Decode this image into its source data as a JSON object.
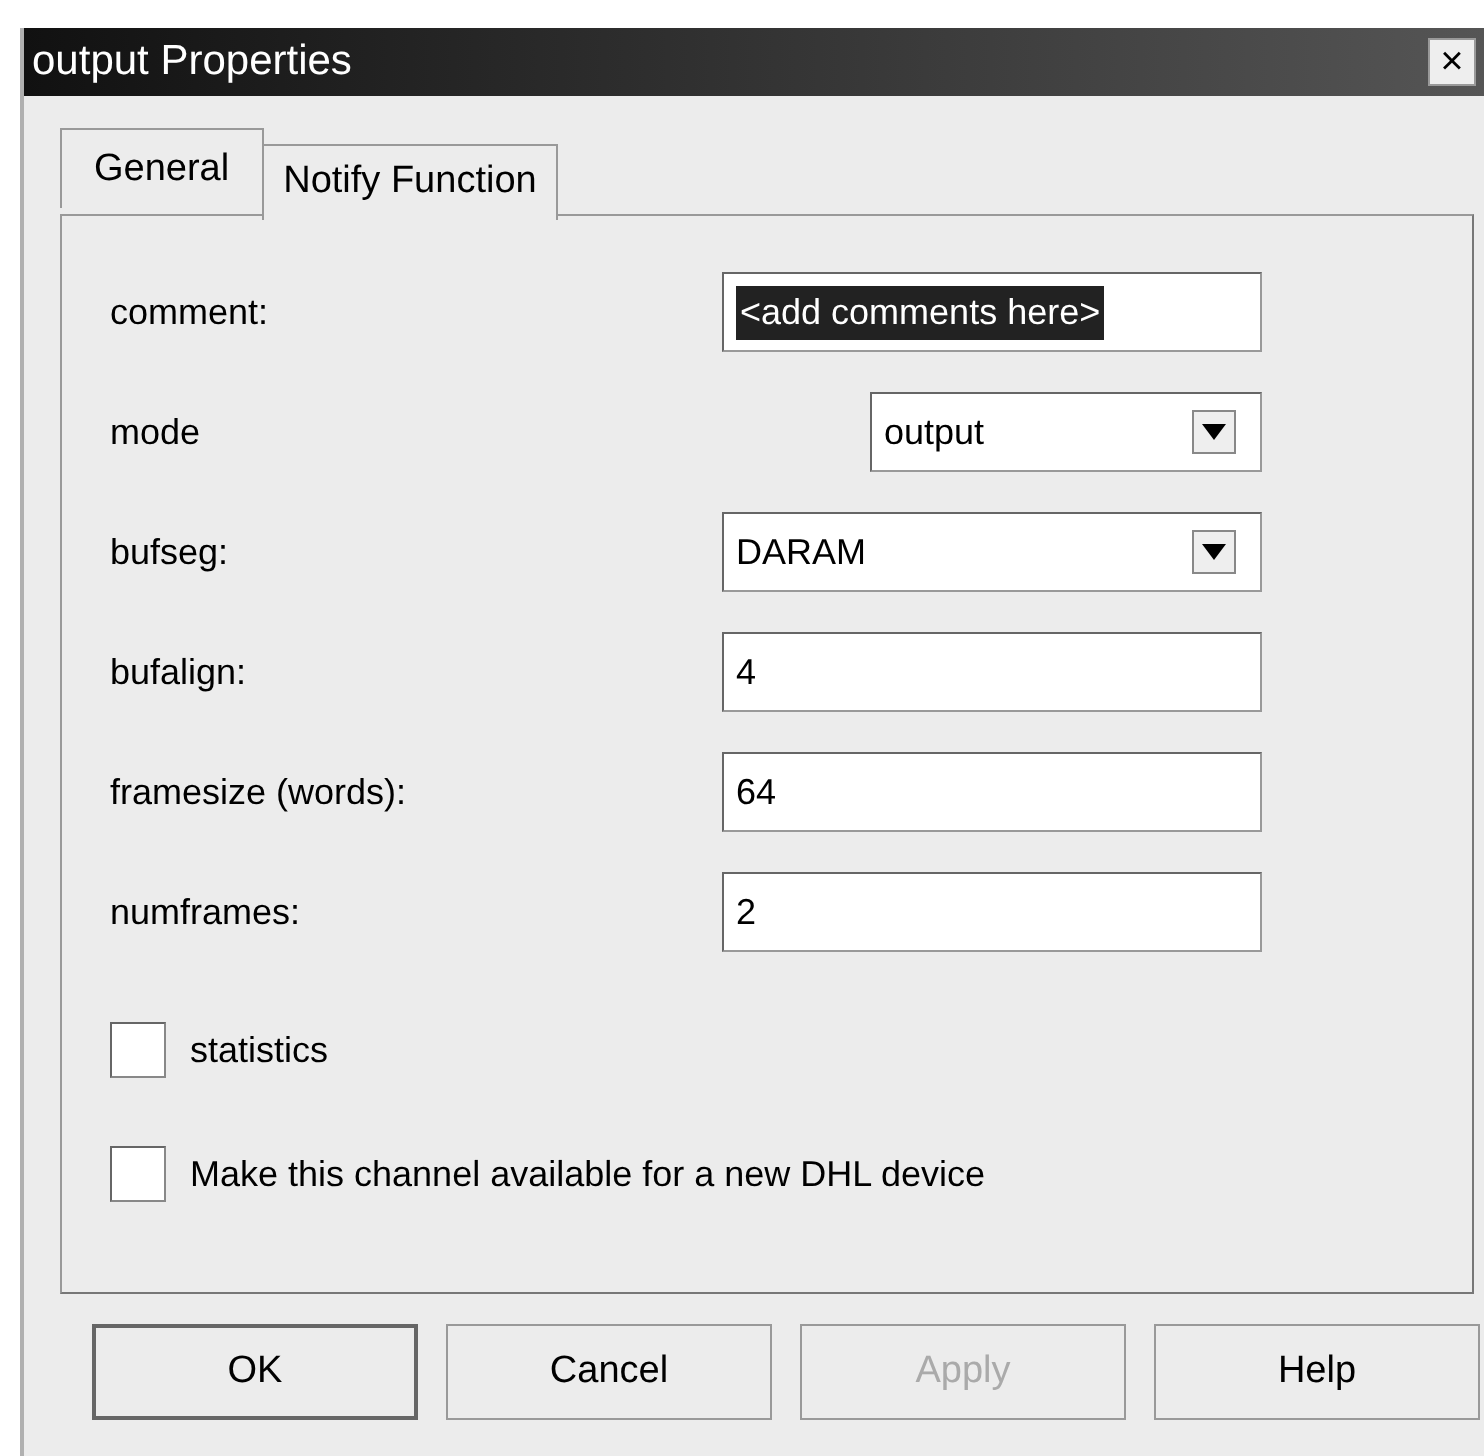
{
  "window": {
    "title": "output Properties",
    "close": "×"
  },
  "tabs": [
    {
      "label": "General",
      "selected": true
    },
    {
      "label": "Notify Function",
      "selected": false
    }
  ],
  "fields": [
    {
      "label": "comment:",
      "kind": "text",
      "value": "<add comments here>",
      "text_selected": true
    },
    {
      "label": "mode",
      "kind": "compact-select",
      "value": "output"
    },
    {
      "label": "bufseg:",
      "kind": "select",
      "value": "DARAM"
    },
    {
      "label": "bufalign:",
      "kind": "text",
      "value": "4",
      "text_selected": false
    },
    {
      "label": "framesize (words):",
      "kind": "text",
      "value": "64",
      "text_selected": false
    },
    {
      "label": "numframes:",
      "kind": "text",
      "value": "2",
      "text_selected": false
    }
  ],
  "checkboxes": [
    {
      "label": "statistics",
      "checked": false
    },
    {
      "label": "Make this channel available for a new DHL device",
      "checked": false
    }
  ],
  "buttons": [
    {
      "label": "OK",
      "default": true,
      "disabled": false
    },
    {
      "label": "Cancel",
      "default": false,
      "disabled": false
    },
    {
      "label": "Apply",
      "default": false,
      "disabled": true
    },
    {
      "label": "Help",
      "default": false,
      "disabled": false
    }
  ]
}
